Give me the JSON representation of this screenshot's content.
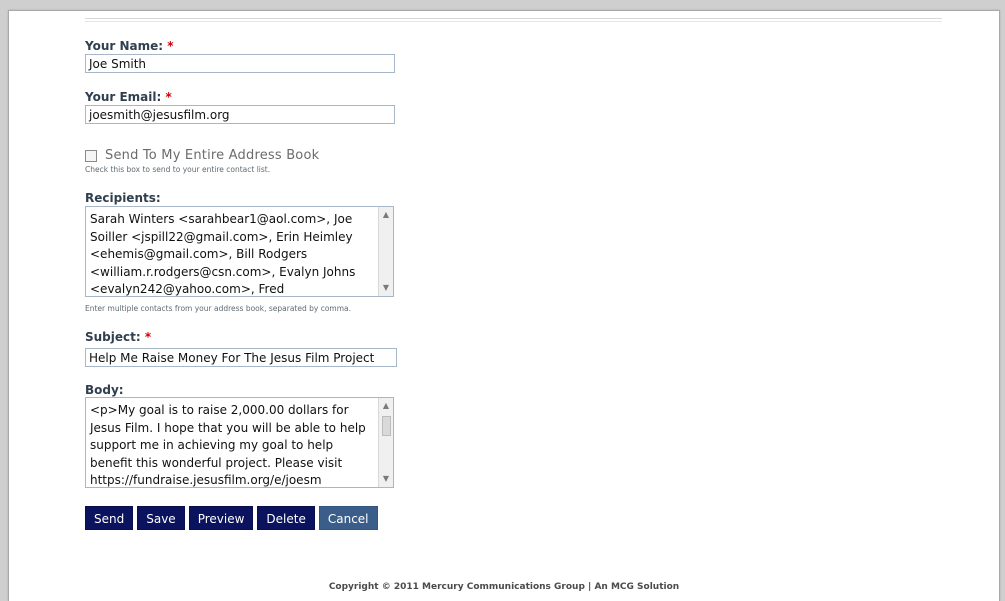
{
  "form": {
    "name_label": "Your Name:",
    "name_required": "*",
    "name_value": "Joe Smith",
    "email_label": "Your Email:",
    "email_required": "*",
    "email_value": "joesmith@jesusfilm.org",
    "address_book_checkbox_label": "Send To My Entire Address Book",
    "address_book_hint": "Check this box to send to your entire contact list.",
    "recipients_label": "Recipients:",
    "recipients_value": "Sarah Winters <sarahbear1@aol.com>, Joe Soiller <jspill22@gmail.com>, Erin Heimley <ehemis@gmail.com>, Bill Rodgers <william.r.rodgers@csn.com>, Evalyn Johns <evalyn242@yahoo.com>, Fred",
    "recipients_hint": "Enter multiple contacts from your address book, separated by comma.",
    "subject_label": "Subject:",
    "subject_required": "*",
    "subject_value": "Help Me Raise Money For The Jesus Film Project",
    "body_label": "Body:",
    "body_value": "<p>My goal is to raise 2,000.00 dollars for Jesus Film. I hope that you will be able to help support me in achieving my goal to help benefit this wonderful project. Please visit https://fundraise.jesusfilm.org/e/joesm"
  },
  "buttons": {
    "send": "Send",
    "save": "Save",
    "preview": "Preview",
    "delete": "Delete",
    "cancel": "Cancel"
  },
  "footer": {
    "copyright": "Copyright © 2011 Mercury Communications Group | An MCG Solution"
  },
  "colors": {
    "primary_button": "#0b135f",
    "cancel_button": "#3b5d89",
    "required_mark": "#d00000"
  }
}
